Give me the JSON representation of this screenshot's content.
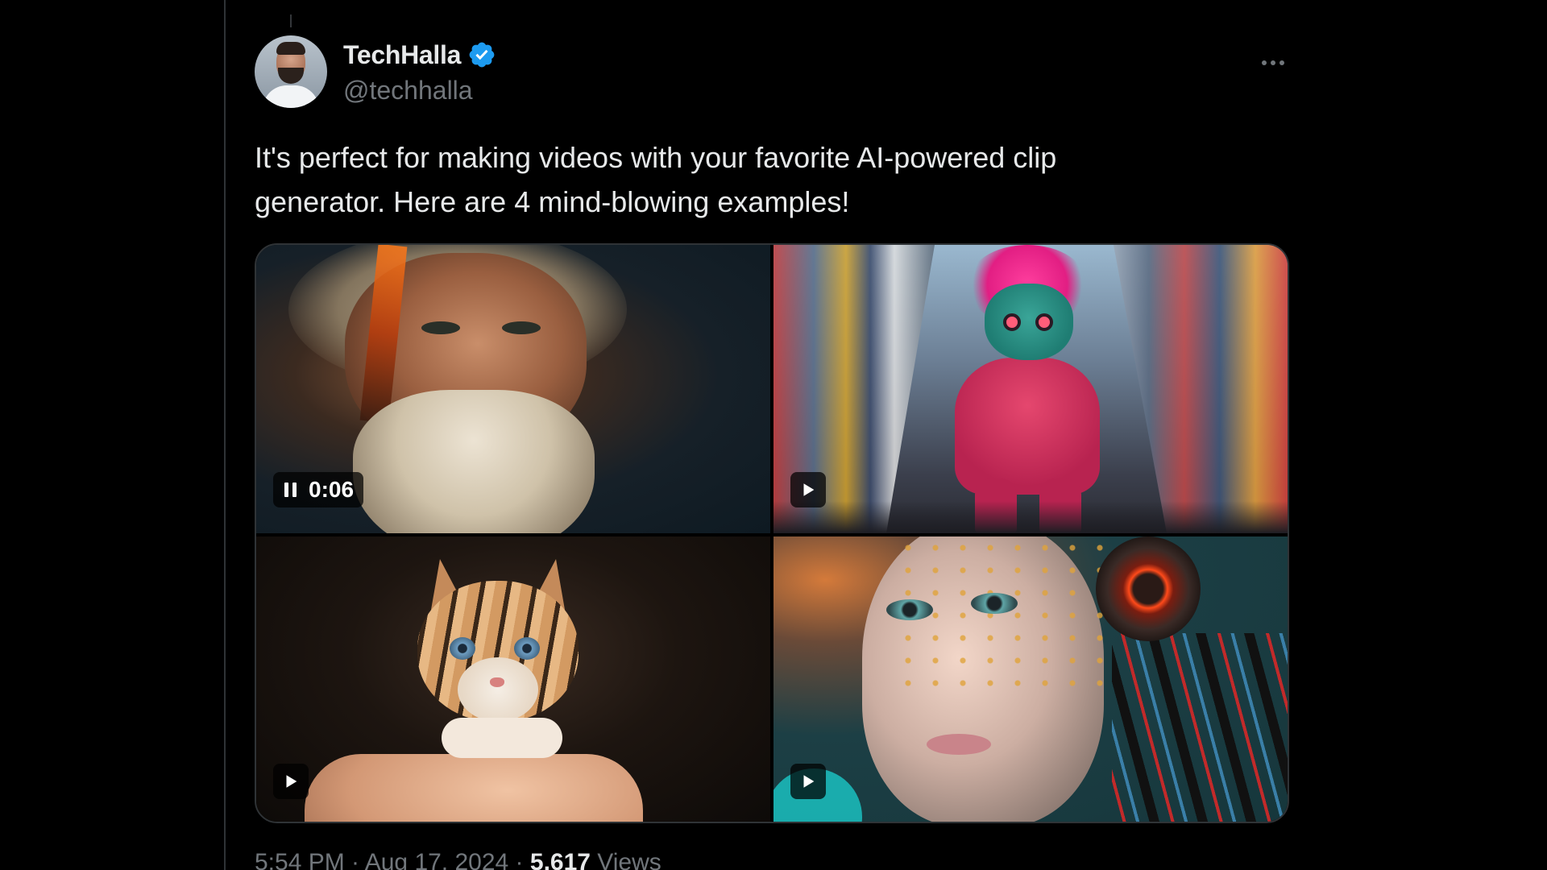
{
  "tweet": {
    "display_name": "TechHalla",
    "handle": "@techhalla",
    "verified_icon": "verified-badge-icon",
    "more_icon": "more-options-icon",
    "text": "It's perfect for making videos with your favorite AI-powered clip\ngenerator. Here are 4 mind-blowing examples!",
    "media": [
      {
        "kind": "video",
        "subject": "old-man-portrait",
        "state": "playing",
        "duration": "0:06",
        "control_icon": "pause-icon"
      },
      {
        "kind": "video",
        "subject": "pink-creature-city",
        "state": "paused",
        "control_icon": "play-icon"
      },
      {
        "kind": "video",
        "subject": "kitten-on-finger",
        "state": "paused",
        "control_icon": "play-icon"
      },
      {
        "kind": "video",
        "subject": "cyborg-woman",
        "state": "paused",
        "control_icon": "play-icon"
      }
    ],
    "footer": {
      "time": "5:54 PM · Aug 17, 2024 · ",
      "views": "5,617",
      "views_suffix": " Views"
    }
  },
  "colors": {
    "background": "#000000",
    "text_primary": "#e7e9ea",
    "text_secondary": "#71767b",
    "verified_blue": "#1d9bf0",
    "border": "#2f3336"
  }
}
